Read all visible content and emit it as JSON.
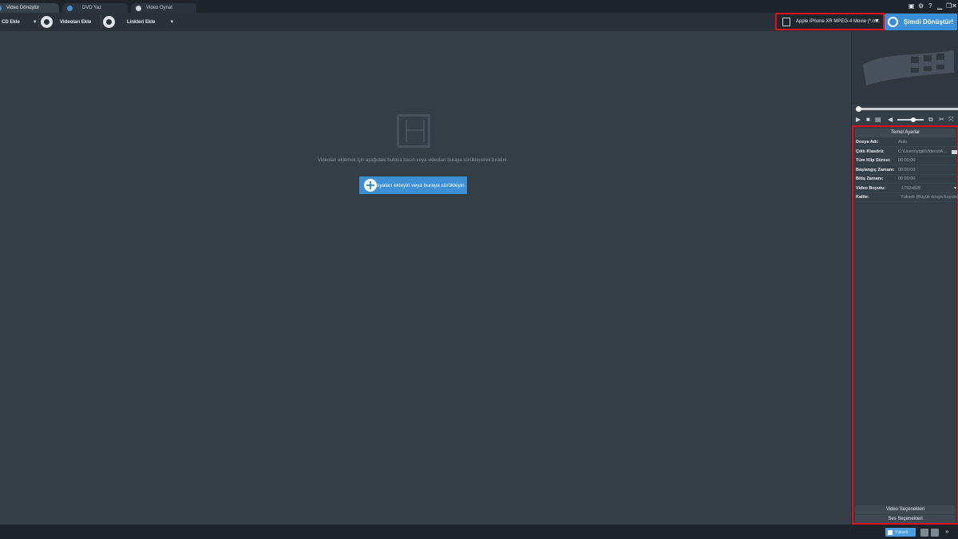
{
  "tabs": [
    {
      "label": "Video Dönüştür",
      "active": true
    },
    {
      "label": "DVD Yaz",
      "active": false
    },
    {
      "label": "Video Oynat",
      "active": false
    }
  ],
  "toolbar": {
    "cd_add": "CD Ekle",
    "add_videos": "Videoları Ekle",
    "add_links": "Linkleri Ekle",
    "profile": "Apple iPhone XR MPEG-4 Movie (*.m...",
    "convert_now": "Şimdi Dönüştür!"
  },
  "main": {
    "hint": "Videoları eklemek için aşağıdaki butona basın veya videoları buraya sürükleyerek bırakın.",
    "add_files": "Dosyaları ekleyin veya buraya sürükleyin"
  },
  "settings": {
    "title": "Temel Ayarlar",
    "rows": [
      {
        "key": "Dosya Adı:",
        "value": "Auto"
      },
      {
        "key": "Çıktı Klasörü:",
        "value": "C:\\Users\\yigit\\Videos\\A..."
      },
      {
        "key": "Tüm Klip Süresi:",
        "value": "00:00:00"
      },
      {
        "key": "Başlangıç Zamanı:",
        "value": "00:00:00"
      },
      {
        "key": "Bitiş Zamanı:",
        "value": "00:00:00"
      },
      {
        "key": "Video Boyutu:",
        "value": "1792x828"
      },
      {
        "key": "Kalite:",
        "value": "Yüksek (Büyük dosya boyutu)"
      }
    ],
    "video_options": "Video Seçenekleri",
    "audio_options": "Ses Seçenekleri"
  },
  "status": {
    "upgrade": "Yükselt"
  },
  "colors": {
    "accent": "#3a8fd9",
    "highlight": "#e0101a",
    "background": "#343e47"
  }
}
